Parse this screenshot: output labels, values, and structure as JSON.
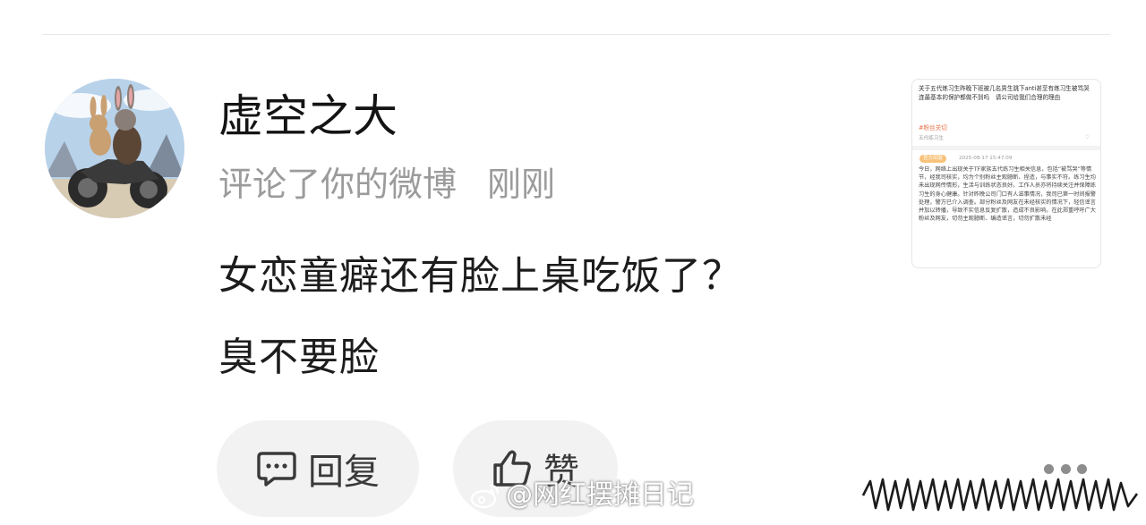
{
  "comment_card": {
    "username": "虚空之大",
    "action": "评论了你的微博",
    "time": "刚刚",
    "comment_lines": [
      "女恋童癖还有脸上桌吃饭了？",
      "臭不要脸"
    ],
    "reply_label": "回复",
    "like_label": "赞"
  },
  "referenced_post": {
    "title": "关于五代练习生昨晚下班被几名男生跳下anti甚至有练习生被骂哭　连最基本的保护都做不到吗　请公司给我们合理的理由",
    "tag": "#粉丝关切",
    "source": "五代练习生",
    "badge": "官方回复",
    "date": "2025-08-17 15:47:09",
    "body": "今日，网络上出现关于TF家族五代练习生相关信息，包括“被骂哭”等情节，经我司核实，均为个别粉丝主观臆断、捏造，与事实不符。练习生均未出现网传情形，生活与训练状态良好。工作人员亦将持续关注并保障练习生的身心健康。针对昨晚公司门口有人滋事情况，我司已第一时间报警处理，警方已介入调查。部分粉丝及网友在未经核实的情况下，轻信谣言并加以转播，导致不实信息反复扩散，造成不良影响。在此郑重呼吁广大粉丝及网友，切勿主观臆断、编造谣言，切勿扩散未经"
  },
  "watermark": "@网红摆摊日记",
  "icons": {
    "avatar": "rabbit-motorcycle-avatar",
    "reply": "comment-bubble-icon",
    "like": "thumbs-up-icon",
    "more": "more-dots-icon",
    "weibo": "weibo-logo-icon"
  },
  "colors": {
    "meta_gray": "#9b9b9b",
    "button_bg": "#f2f2f2",
    "tag_orange": "#e8744a"
  }
}
